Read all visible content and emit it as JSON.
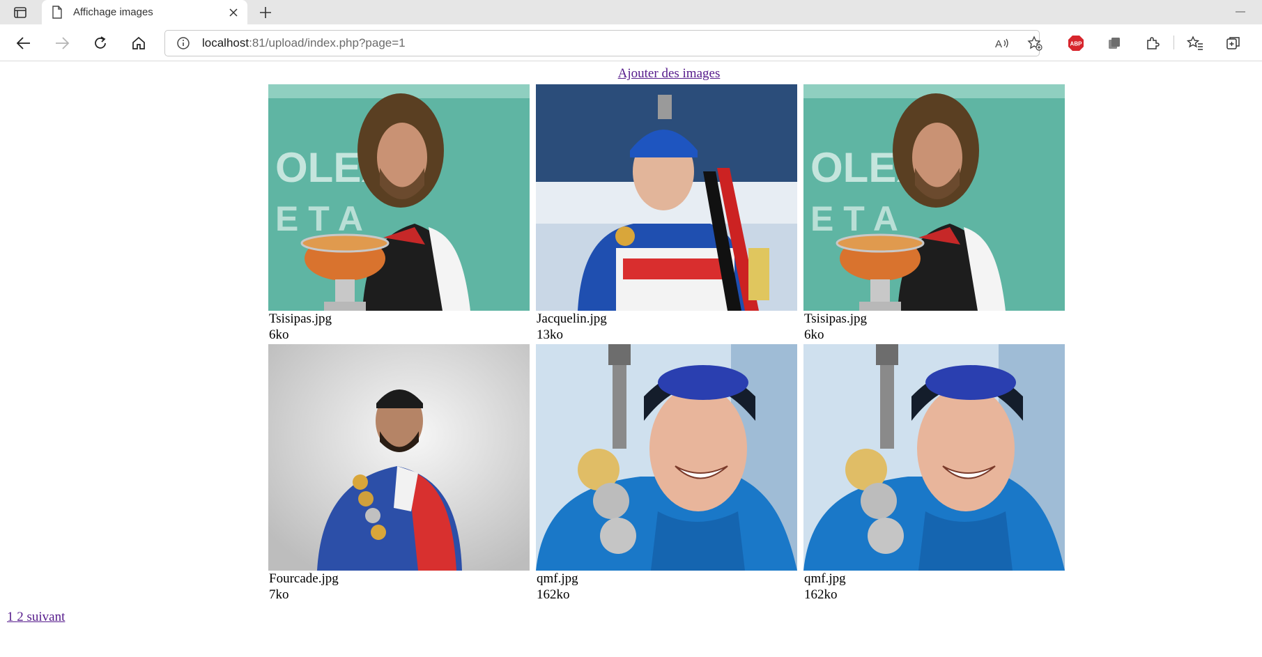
{
  "browser": {
    "tab_title": "Affichage images",
    "url_host": "localhost",
    "url_rest": ":81/upload/index.php?page=1",
    "extension_abp_label": "ABP"
  },
  "page": {
    "add_images_link": "Ajouter des images",
    "images": [
      {
        "name": "Tsisipas.jpg",
        "size": "6ko"
      },
      {
        "name": "Jacquelin.jpg",
        "size": "13ko"
      },
      {
        "name": "Tsisipas.jpg",
        "size": "6ko"
      },
      {
        "name": "Fourcade.jpg",
        "size": "7ko"
      },
      {
        "name": "qmf.jpg",
        "size": "162ko"
      },
      {
        "name": "qmf.jpg",
        "size": "162ko"
      }
    ],
    "pagination": {
      "page1": "1",
      "page2": "2",
      "next": "suivant"
    }
  },
  "colors": {
    "link_visited": "#551a8b",
    "chrome_bg": "#e6e6e6",
    "abp_red": "#d7262d"
  }
}
